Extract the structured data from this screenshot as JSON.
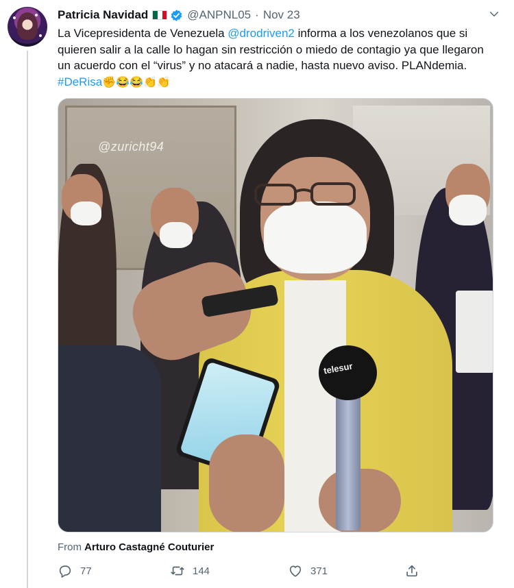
{
  "author": {
    "display_name": "Patricia Navidad",
    "handle": "@ANPNL05",
    "separator": "·",
    "time": "Nov 23",
    "verified": true,
    "flag_colors": [
      "#006847",
      "#ffffff",
      "#ce1126"
    ]
  },
  "tweet": {
    "text_1": "La Vicepresidenta de Venezuela ",
    "mention": "@drodriven2",
    "text_2": " informa a los venezolanos que si quieren salir a la calle lo hagan sin restricción o miedo de contagio ya que llegaron un acuerdo con el “virus” y no atacará a nadie, hasta nuevo aviso. PLANdemia. ",
    "hashtag": "#DeRisa",
    "emojis": "✊😂😂👏👏"
  },
  "media": {
    "watermark": "@zuricht94",
    "mic_label": "telesur"
  },
  "attribution": {
    "prefix": "From ",
    "source_name": "Arturo Castagné Couturier"
  },
  "actions": {
    "replies": "77",
    "retweets": "144",
    "likes": "371"
  },
  "icons": {
    "reply": "reply-icon",
    "retweet": "retweet-icon",
    "like": "heart-icon",
    "share": "share-icon",
    "menu": "chevron-down-icon",
    "verified": "verified-badge-icon"
  },
  "colors": {
    "link": "#1d9bf0",
    "secondary_text": "#536471",
    "verified": "#1d9bf0"
  }
}
